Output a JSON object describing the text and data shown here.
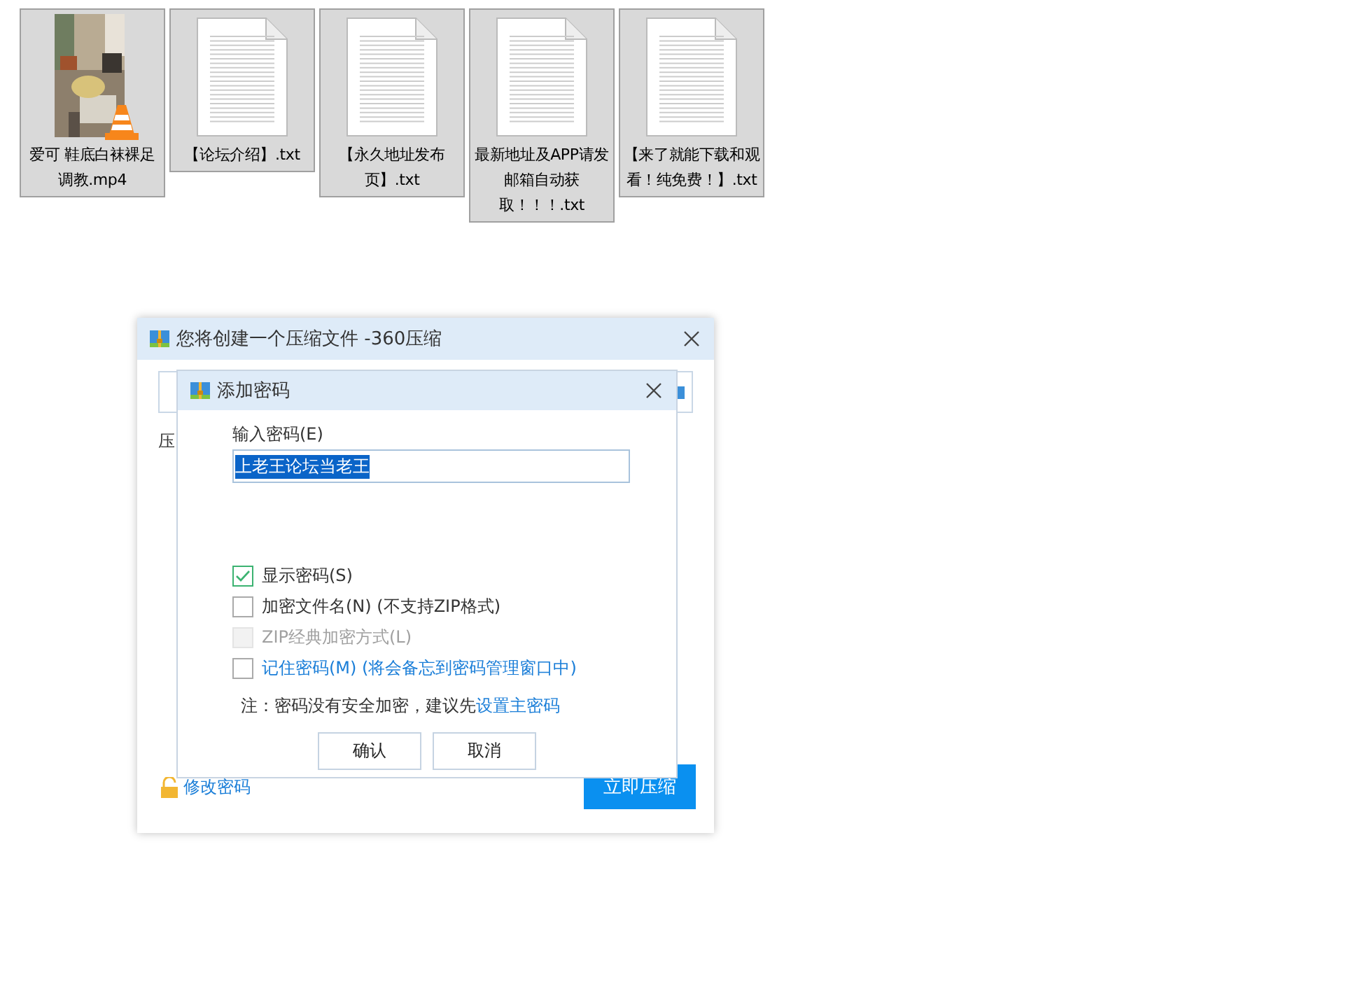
{
  "files": [
    {
      "name": "爱可 鞋底白袜裸足调教.mp4",
      "kind": "video"
    },
    {
      "name": "【论坛介绍】.txt",
      "kind": "text"
    },
    {
      "name": "【永久地址发布页】.txt",
      "kind": "text"
    },
    {
      "name": "最新地址及APP请发邮箱自动获取！！！.txt",
      "kind": "text"
    },
    {
      "name": "【来了就能下载和观看！纯免费！】.txt",
      "kind": "text"
    }
  ],
  "compress_dialog": {
    "title": "您将创建一个压缩文件 -360压缩",
    "label": "压",
    "change_password_link": "修改密码",
    "compress_button": "立即压缩"
  },
  "password_dialog": {
    "title": "添加密码",
    "password_label": "输入密码(E)",
    "password_value": "上老王论坛当老王",
    "value_selected": true,
    "options": [
      {
        "label": "显示密码(S)",
        "checked": true,
        "disabled": false,
        "kind": "plain"
      },
      {
        "label": "加密文件名(N) (不支持ZIP格式)",
        "checked": false,
        "disabled": false,
        "kind": "plain"
      },
      {
        "label": "ZIP经典加密方式(L)",
        "checked": false,
        "disabled": true,
        "kind": "plain"
      },
      {
        "label": "记住密码(M) (将会备忘到密码管理窗口中)",
        "checked": false,
        "disabled": false,
        "kind": "link"
      }
    ],
    "note": "注：密码没有安全加密，建议先",
    "note_link": "设置主密码",
    "buttons": [
      "确认",
      "取消"
    ]
  }
}
